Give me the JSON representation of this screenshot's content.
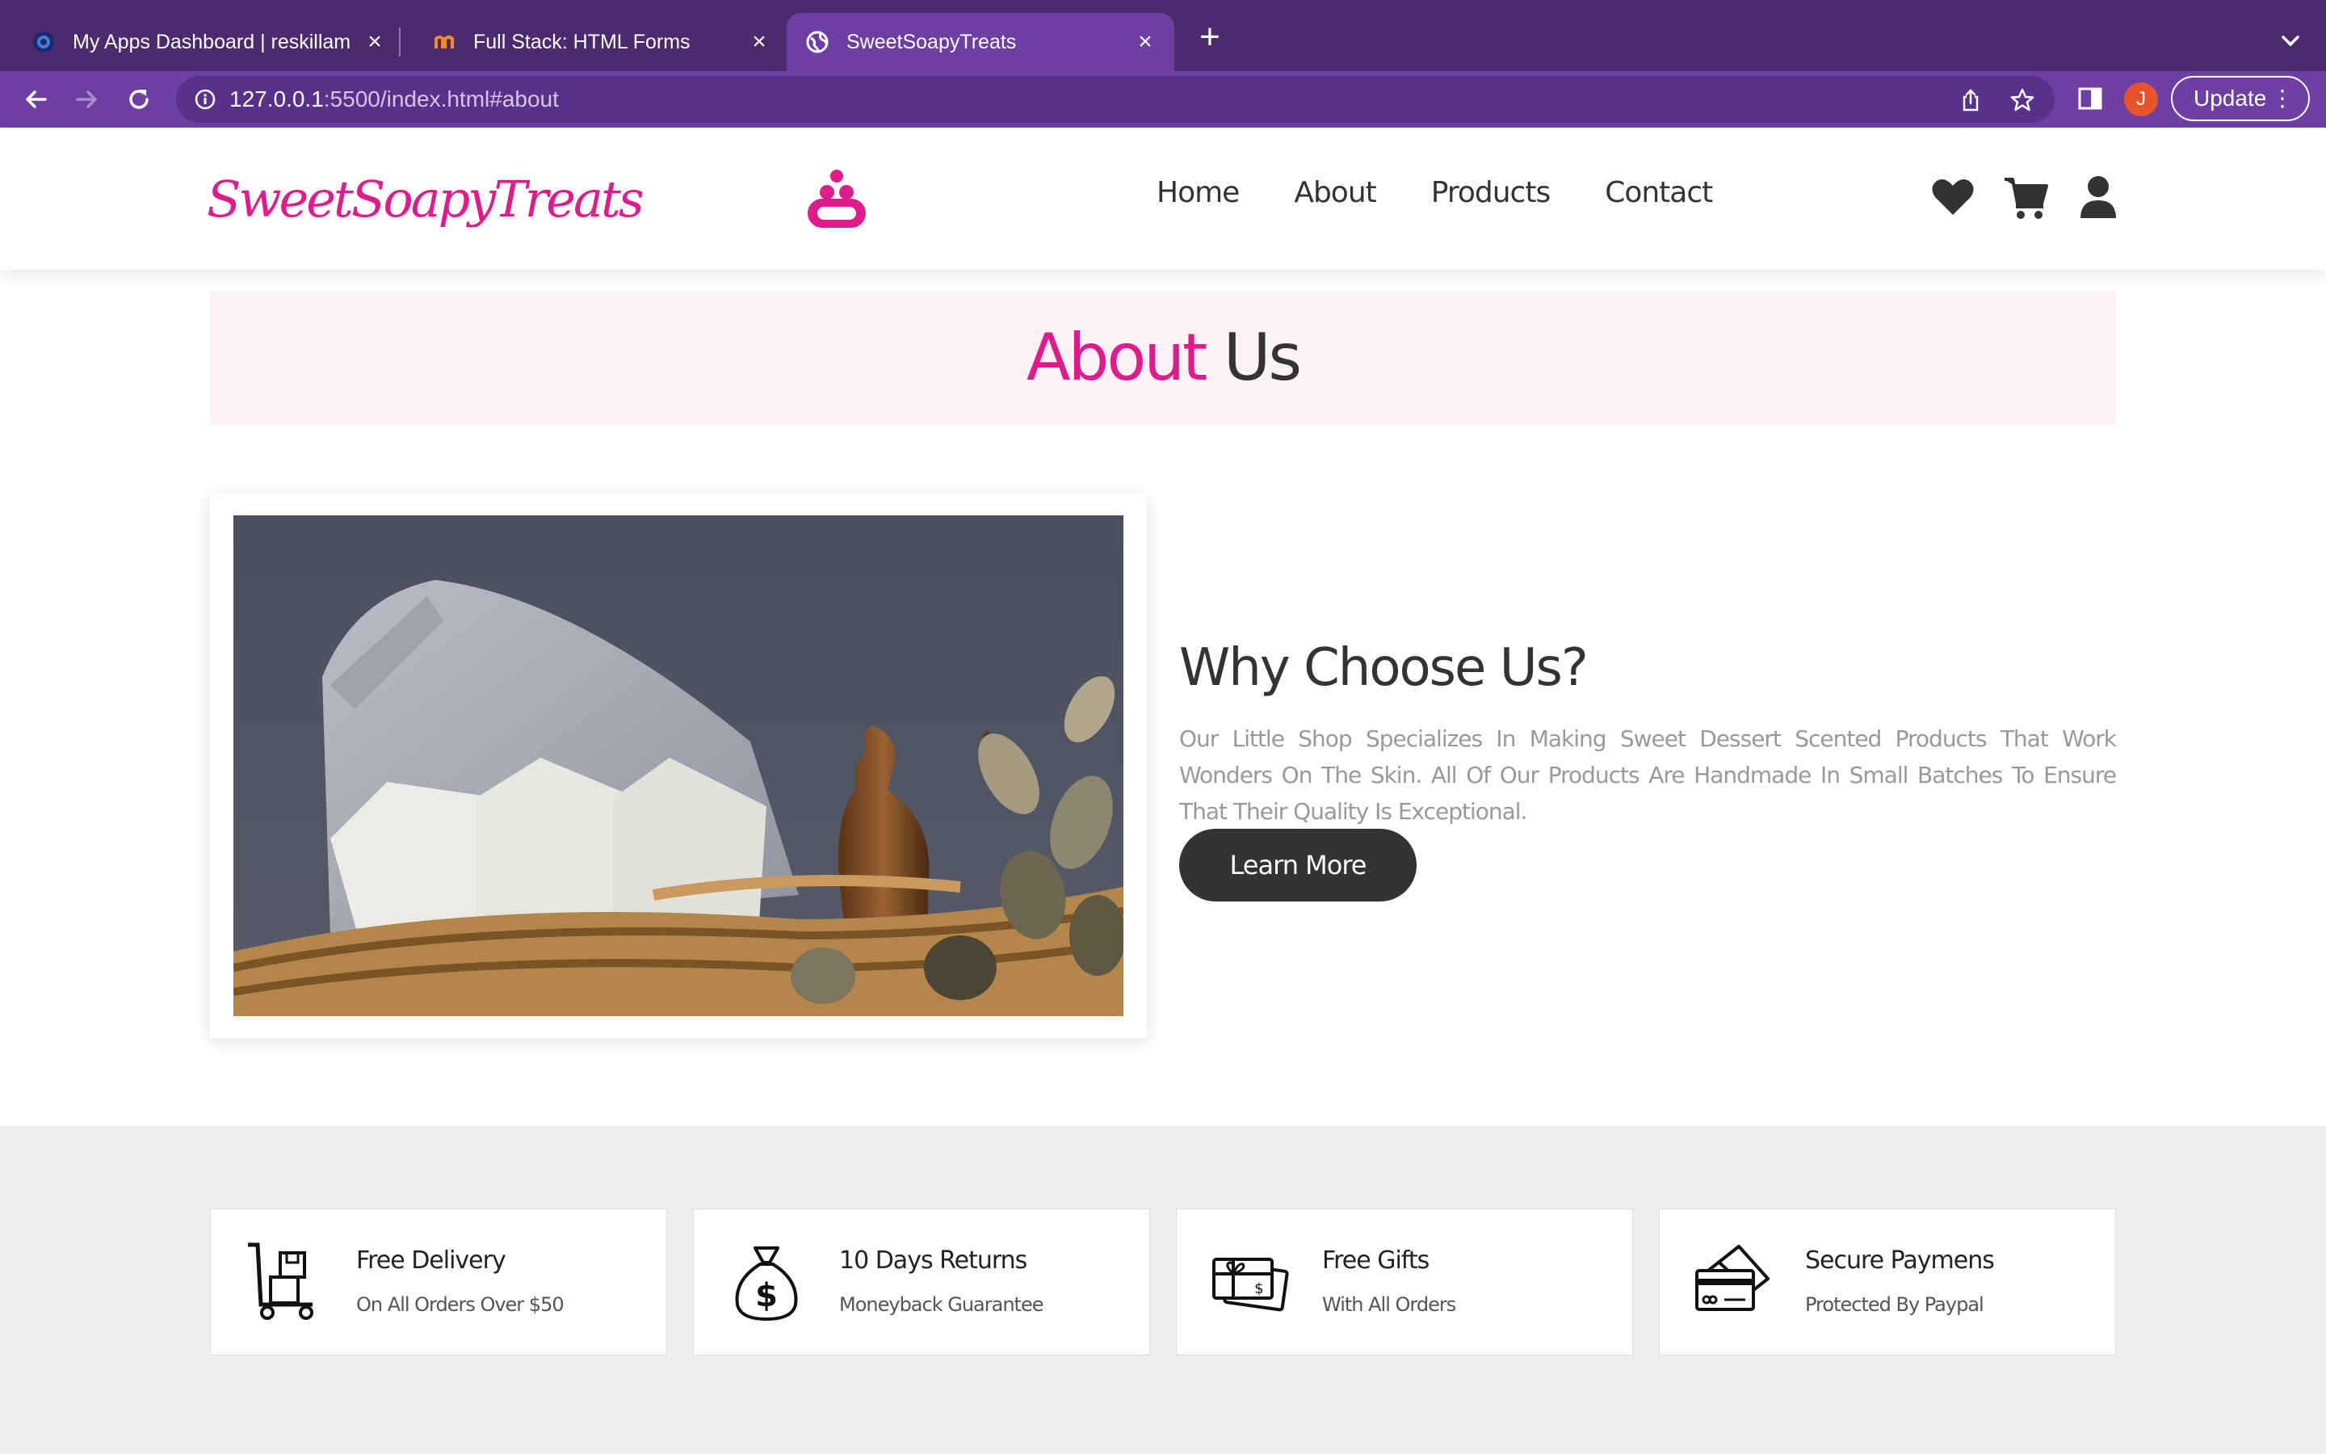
{
  "browser": {
    "tabs": [
      {
        "title": "My Apps Dashboard | reskillam",
        "close": "×"
      },
      {
        "title": "Full Stack: HTML Forms",
        "close": "×"
      },
      {
        "title": "SweetSoapyTreats",
        "close": "×"
      }
    ],
    "new_tab": "+",
    "url_host": "127.0.0.1",
    "url_path": ":5500/index.html#about",
    "profile_initial": "J",
    "update_label": "Update",
    "update_menu": "⋮"
  },
  "site": {
    "logo": "SweetSoapyTreats",
    "nav": [
      "Home",
      "About",
      "Products",
      "Contact"
    ],
    "brand_color": "#e01b8c"
  },
  "about": {
    "heading_highlight": "About",
    "heading_rest": "Us",
    "why_title": "Why Choose Us?",
    "why_text": "Our Little Shop Specializes In Making Sweet Dessert Scented Products That Work Wonders On The Skin. All Of Our Products Are Handmade In Small Batches To Ensure That Their Quality Is Exceptional.",
    "learn_more": "Learn More"
  },
  "features": [
    {
      "title": "Free Delivery",
      "subtitle": "On All Orders Over $50",
      "icon": "delivery-cart-icon"
    },
    {
      "title": "10 Days Returns",
      "subtitle": "Moneyback Guarantee",
      "icon": "money-bag-icon"
    },
    {
      "title": "Free Gifts",
      "subtitle": "With All Orders",
      "icon": "gift-card-icon"
    },
    {
      "title": "Secure Paymens",
      "subtitle": "Protected By Paypal",
      "icon": "credit-card-icon"
    }
  ]
}
